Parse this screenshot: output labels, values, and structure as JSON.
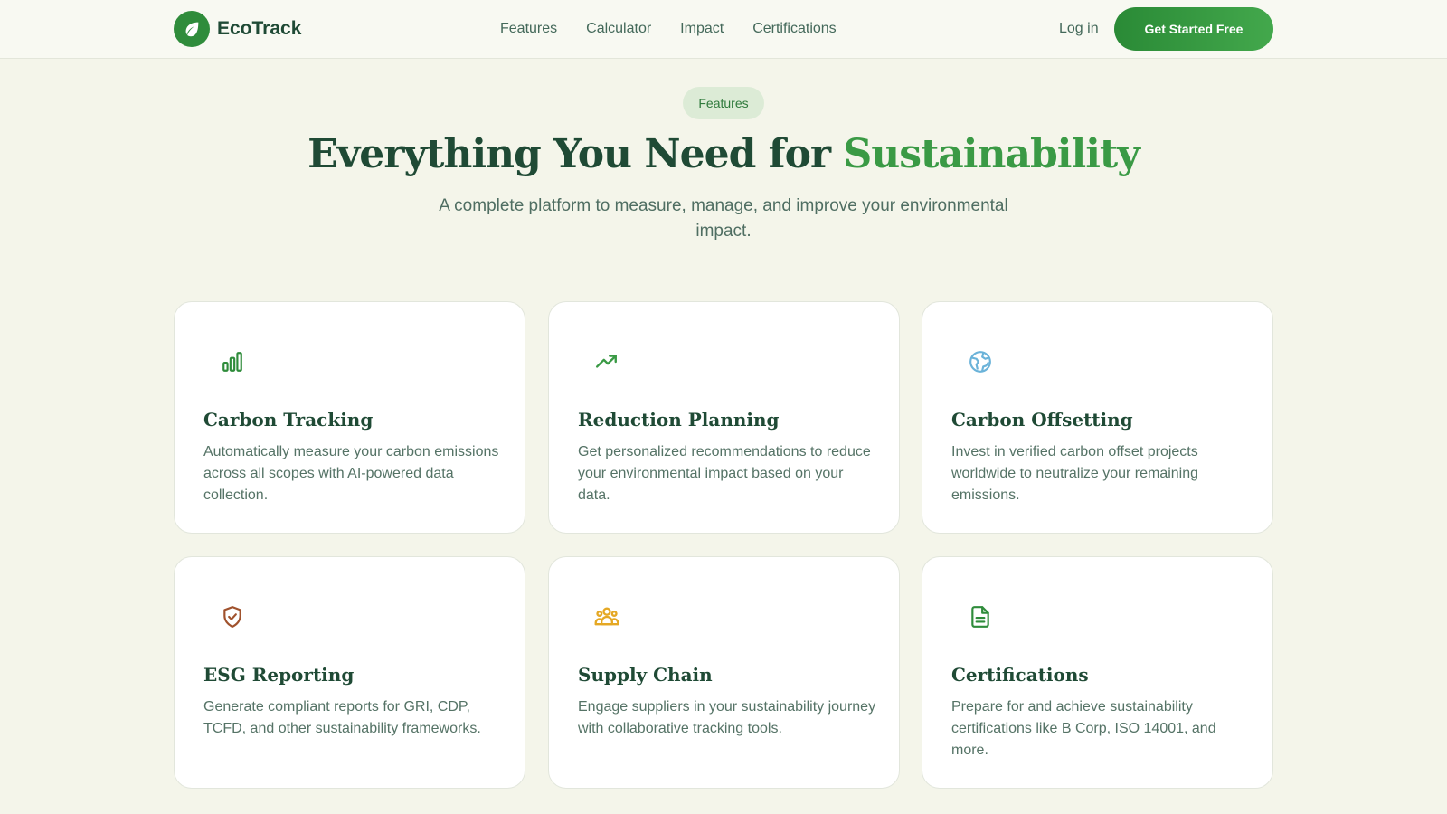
{
  "brand": {
    "name": "EcoTrack",
    "icon": "leaf-icon"
  },
  "nav": {
    "items": [
      {
        "label": "Features"
      },
      {
        "label": "Calculator"
      },
      {
        "label": "Impact"
      },
      {
        "label": "Certifications"
      }
    ],
    "login_label": "Log in",
    "cta_label": "Get Started Free"
  },
  "hero": {
    "badge": "Features",
    "title_main": "Everything You Need for ",
    "title_accent": "Sustainability",
    "subtitle": "A complete platform to measure, manage, and improve your environmental impact."
  },
  "features": [
    {
      "icon": "bar-chart-icon",
      "icon_color": "#2f8c3b",
      "title": "Carbon Tracking",
      "description": "Automatically measure your carbon emissions across all scopes with AI-powered data collection."
    },
    {
      "icon": "trending-up-icon",
      "icon_color": "#3a9a45",
      "title": "Reduction Planning",
      "description": "Get personalized recommendations to reduce your environmental impact based on your data."
    },
    {
      "icon": "globe-icon",
      "icon_color": "#6bb3d9",
      "title": "Carbon Offsetting",
      "description": "Invest in verified carbon offset projects worldwide to neutralize your remaining emissions."
    },
    {
      "icon": "shield-check-icon",
      "icon_color": "#a0522d",
      "title": "ESG Reporting",
      "description": "Generate compliant reports for GRI, CDP, TCFD, and other sustainability frameworks."
    },
    {
      "icon": "users-icon",
      "icon_color": "#e5a824",
      "title": "Supply Chain",
      "description": "Engage suppliers in your sustainability journey with collaborative tracking tools."
    },
    {
      "icon": "document-icon",
      "icon_color": "#2f8c3b",
      "title": "Certifications",
      "description": "Prepare for and achieve sustainability certifications like B Corp, ISO 14001, and more."
    }
  ],
  "colors": {
    "primary": "#2f8c3b",
    "accent_text": "#3a9a45",
    "heading": "#1f4a35",
    "background": "#f4f5ea"
  }
}
